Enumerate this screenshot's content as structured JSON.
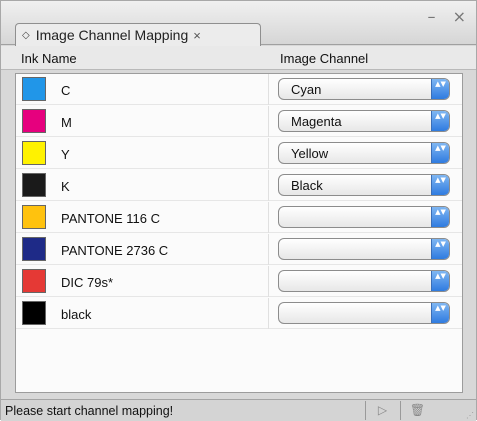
{
  "panel": {
    "tab_label": "Image Channel Mapping",
    "tab_close": "×",
    "tab_diamond": "◇",
    "win_controls": "– ×"
  },
  "columns": {
    "ink": "Ink Name",
    "channel": "Image Channel"
  },
  "rows": [
    {
      "ink": "C",
      "channel": "Cyan",
      "color": "#2196e8"
    },
    {
      "ink": "M",
      "channel": "Magenta",
      "color": "#e6007e"
    },
    {
      "ink": "Y",
      "channel": "Yellow",
      "color": "#fff200"
    },
    {
      "ink": "K",
      "channel": "Black",
      "color": "#1a1a1a"
    },
    {
      "ink": "PANTONE 116 C",
      "channel": "",
      "color": "#ffc20e"
    },
    {
      "ink": "PANTONE 2736 C",
      "channel": "",
      "color": "#1e2a87"
    },
    {
      "ink": "DIC 79s*",
      "channel": "",
      "color": "#e53935"
    },
    {
      "ink": "black",
      "channel": "",
      "color": "#000000"
    }
  ],
  "stepper_glyph": "▲▼",
  "footer": {
    "status": "Please start channel mapping!",
    "play_icon": "▷",
    "delete_icon": "🗑"
  }
}
